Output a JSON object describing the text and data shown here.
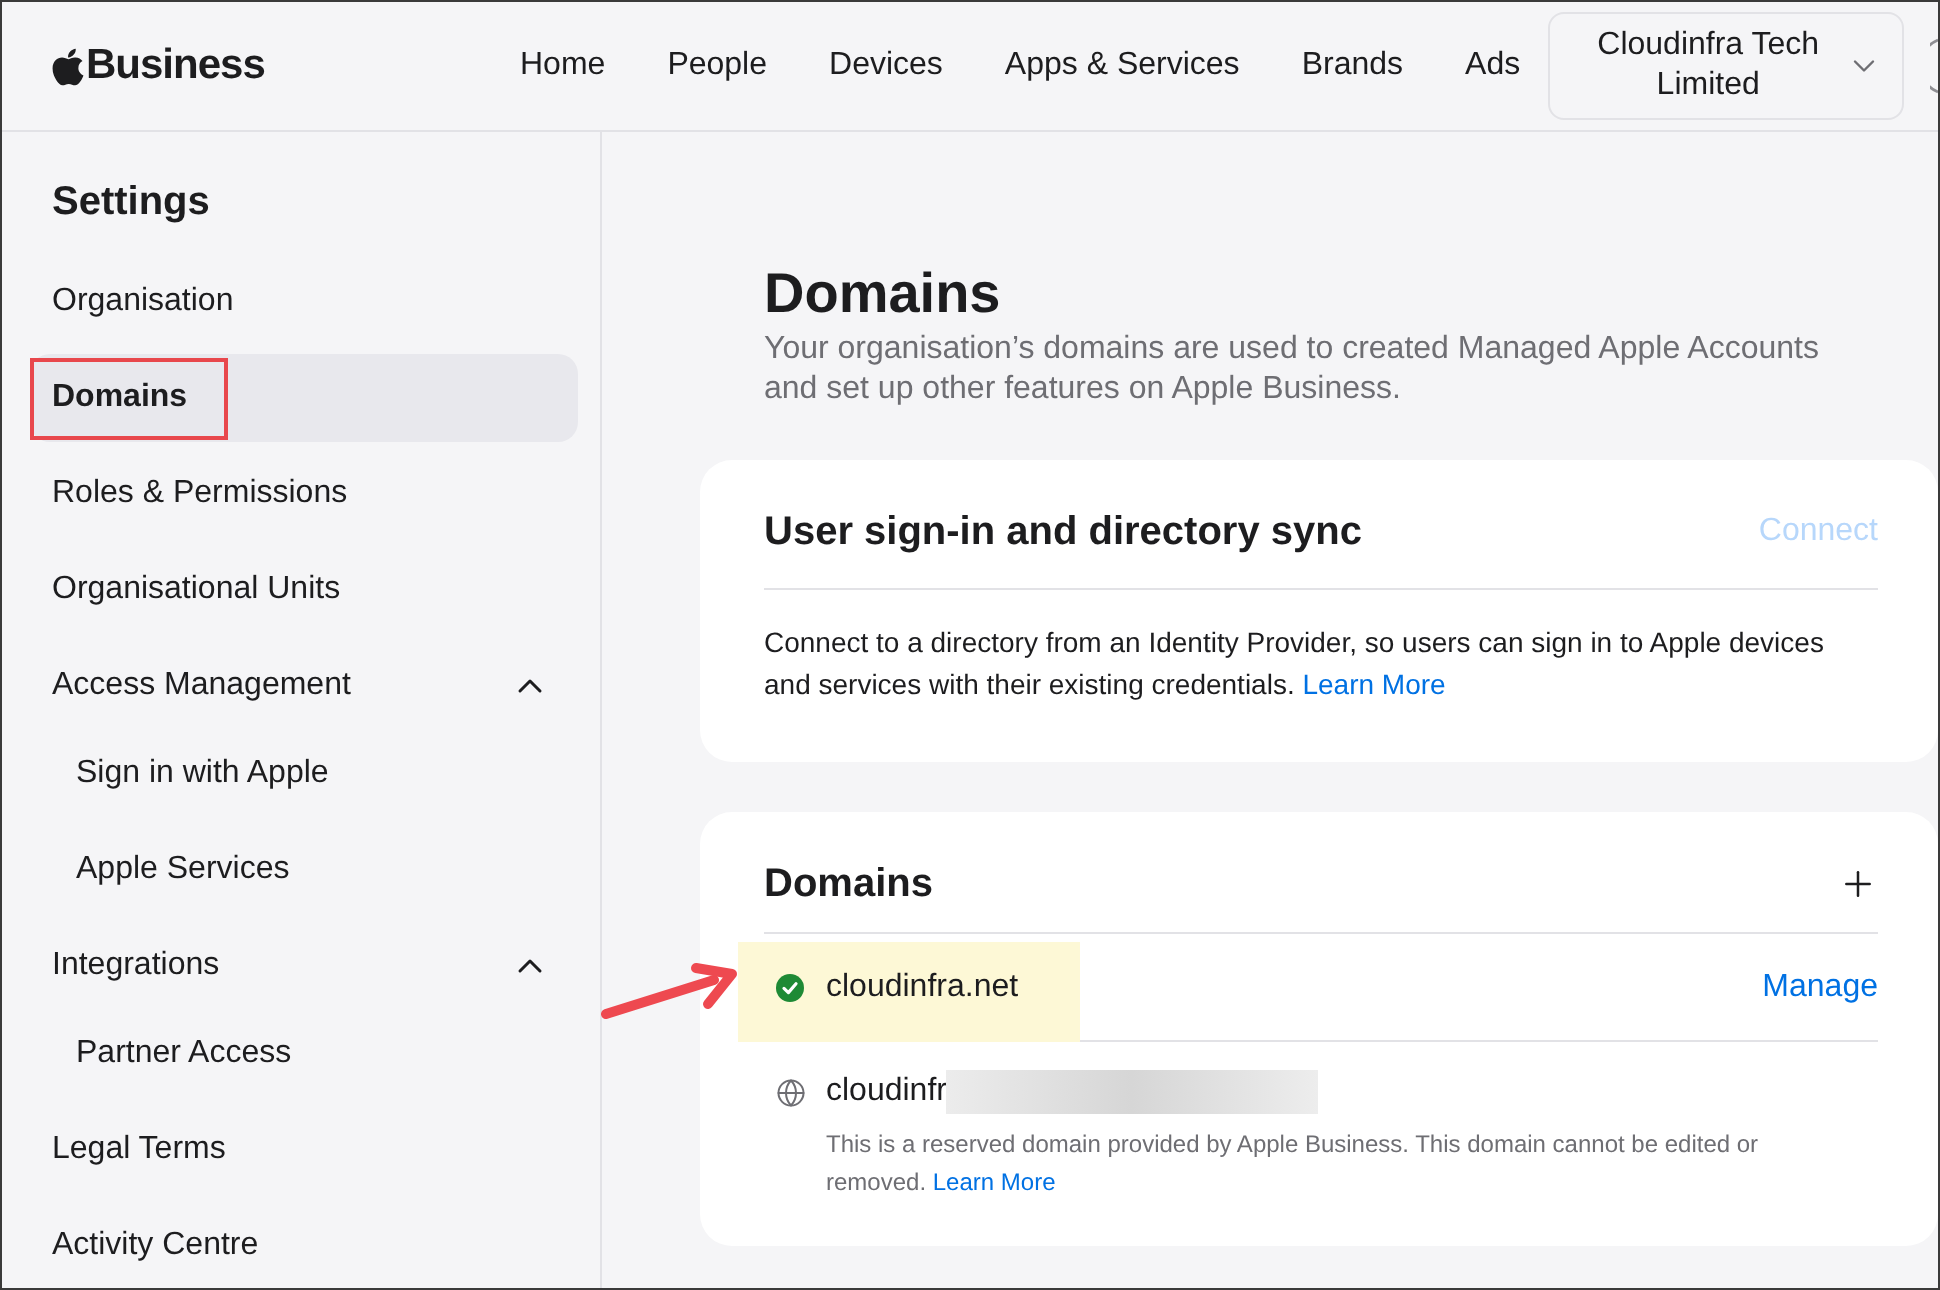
{
  "header": {
    "logo": "Business",
    "nav": [
      {
        "label": "Home"
      },
      {
        "label": "People"
      },
      {
        "label": "Devices"
      },
      {
        "label": "Apps & Services"
      },
      {
        "label": "Brands"
      },
      {
        "label": "Ads"
      }
    ],
    "org_menu": {
      "label": "Cloudinfra Tech Limited"
    }
  },
  "sidebar": {
    "title": "Settings",
    "items": [
      {
        "label": "Organisation",
        "selected": false,
        "outlined": false
      },
      {
        "label": "Domains",
        "selected": true,
        "outlined": true
      },
      {
        "label": "Roles & Permissions",
        "selected": false,
        "outlined": false
      },
      {
        "label": "Organisational Units",
        "selected": false,
        "outlined": false
      },
      {
        "label": "Access Management",
        "selected": false,
        "outlined": false,
        "expanded": true,
        "children": [
          {
            "label": "Sign in with Apple",
            "selected": false,
            "outlined": false
          },
          {
            "label": "Apple Services",
            "selected": false,
            "outlined": false
          }
        ]
      },
      {
        "label": "Integrations",
        "selected": false,
        "outlined": false,
        "expanded": true,
        "children": [
          {
            "label": "Partner Access",
            "selected": false,
            "outlined": false
          }
        ]
      },
      {
        "label": "Legal Terms",
        "selected": false,
        "outlined": false
      },
      {
        "label": "Activity Centre",
        "selected": false,
        "outlined": false
      }
    ]
  },
  "page": {
    "title": "Domains",
    "subtitle": "Your organisation’s domains are used to created Managed Apple Accounts and set up other features on Apple Business."
  },
  "directory_card": {
    "title": "User sign-in and directory sync",
    "action": {
      "label": "Connect",
      "disabled": true
    },
    "description": "Connect to a directory from an Identity Provider, so users can sign in to Apple devices and services with their existing credentials.",
    "link": "Learn More"
  },
  "domains_card": {
    "title": "Domains",
    "domains": [
      {
        "kind": "verified",
        "name": "cloudinfra.net",
        "action": "Manage",
        "highlighted": true,
        "redacted": false
      },
      {
        "kind": "reserved",
        "name": "cloudinfr",
        "highlighted": false,
        "redacted": true,
        "note": "This is a reserved domain provided by Apple Business. This domain cannot be edited or removed.",
        "link": "Learn More"
      }
    ]
  }
}
